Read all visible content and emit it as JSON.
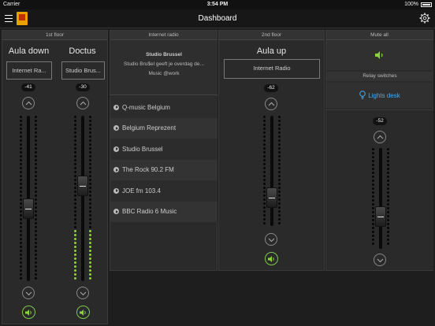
{
  "status": {
    "carrier": "Carrier",
    "time": "3:54 PM",
    "battery": "100%"
  },
  "nav": {
    "title": "Dashboard"
  },
  "colors": {
    "accent_green": "#8bd43a",
    "accent_blue": "#4aa8e8"
  },
  "floor1": {
    "header": "1st floor",
    "zones": [
      {
        "name": "Aula down",
        "source": "Internet Ra...",
        "volume": "-41",
        "level_fraction": 0.43
      },
      {
        "name": "Doctus",
        "source": "Studio Brus...",
        "volume": "-30",
        "level_fraction": 0.58
      }
    ]
  },
  "radio": {
    "header": "Internet radio",
    "now_title": "Studio Brussel",
    "now_desc": "Studio Bru$el geeft je overdag de...",
    "now_sub": "Music @work",
    "stations": [
      "Q-music Belgium",
      "Belgium Reprezent",
      "Studio Brussel",
      "The Rock 90.2 FM",
      "JOE fm 103.4",
      "BBC Radio 6 Music"
    ]
  },
  "floor2": {
    "header": "2nd floor",
    "zone": {
      "name": "Aula up",
      "source": "Internet Radio",
      "volume": "-62"
    }
  },
  "mute": {
    "header": "Mute all",
    "relay_header": "Relay switches",
    "lights_label": "Lights desk",
    "volume": "-52"
  },
  "icons": [
    "menu-icon",
    "app-logo",
    "gear-icon",
    "chevron-up-icon",
    "chevron-down-icon",
    "speaker-icon",
    "play-icon",
    "bulb-icon"
  ]
}
